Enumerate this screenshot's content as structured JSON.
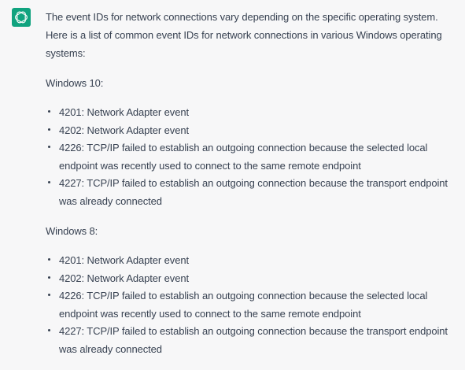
{
  "response": {
    "intro": "The event IDs for network connections vary depending on the specific operating system. Here is a list of common event IDs for network connections in various Windows operating systems:",
    "sections": [
      {
        "heading": "Windows 10:",
        "items": [
          "4201: Network Adapter event",
          "4202: Network Adapter event",
          "4226: TCP/IP failed to establish an outgoing connection because the selected local endpoint was recently used to connect to the same remote endpoint",
          "4227: TCP/IP failed to establish an outgoing connection because the transport endpoint was already connected"
        ]
      },
      {
        "heading": "Windows 8:",
        "items": [
          "4201: Network Adapter event",
          "4202: Network Adapter event",
          "4226: TCP/IP failed to establish an outgoing connection because the selected local endpoint was recently used to connect to the same remote endpoint",
          "4227: TCP/IP failed to establish an outgoing connection because the transport endpoint was already connected"
        ]
      }
    ]
  },
  "colors": {
    "background": "#f7f7f8",
    "text": "#374151",
    "avatar": "#10a37f"
  },
  "icons": {
    "avatar": "openai-logo-icon"
  }
}
